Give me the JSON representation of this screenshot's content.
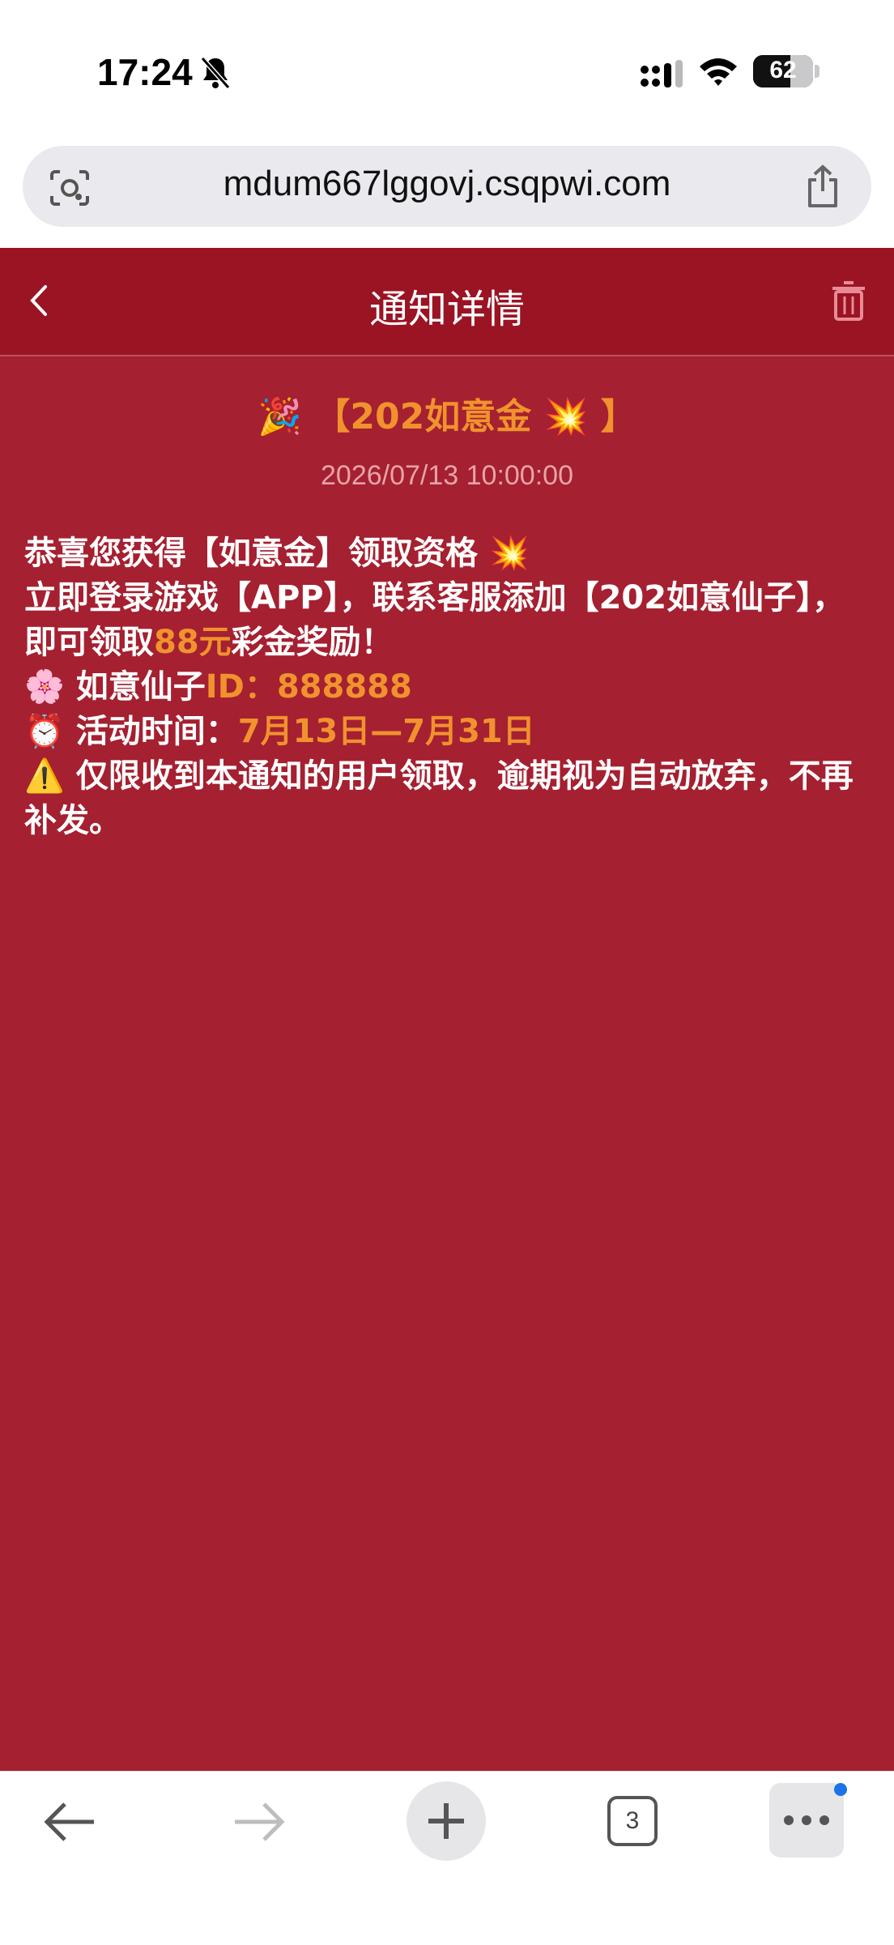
{
  "status_bar": {
    "time": "17:24",
    "battery": "62",
    "battery_level": 0.62
  },
  "url_bar": {
    "url": "mdum667lggovj.csqpwi.com"
  },
  "nav": {
    "title": "通知详情"
  },
  "notice": {
    "title_emoji": "🎉",
    "title": "【202如意金",
    "title_burst": "💥",
    "title_close": "】",
    "time": "2026/07/13 10:00:00",
    "line1": "恭喜您获得【如意金】领取资格",
    "line1_emoji": "💥",
    "line2": "立即登录游戏【APP】，联系客服添加【202如意仙子】，即可领取",
    "line2_amount": "88元",
    "line2_end": "彩金奖励！",
    "line3_emoji": "🌸",
    "line3_label": "如意仙子",
    "line3_id": "ID：888888",
    "line4_emoji": "⏰",
    "line4_label": "活动时间：",
    "line4_value": "7月13日—7月31日",
    "line5_emoji": "⚠️",
    "line5": "仅限收到本通知的用户领取，逾期视为自动放弃，不再补发。"
  },
  "toolbar": {
    "tabs_count": "3"
  }
}
